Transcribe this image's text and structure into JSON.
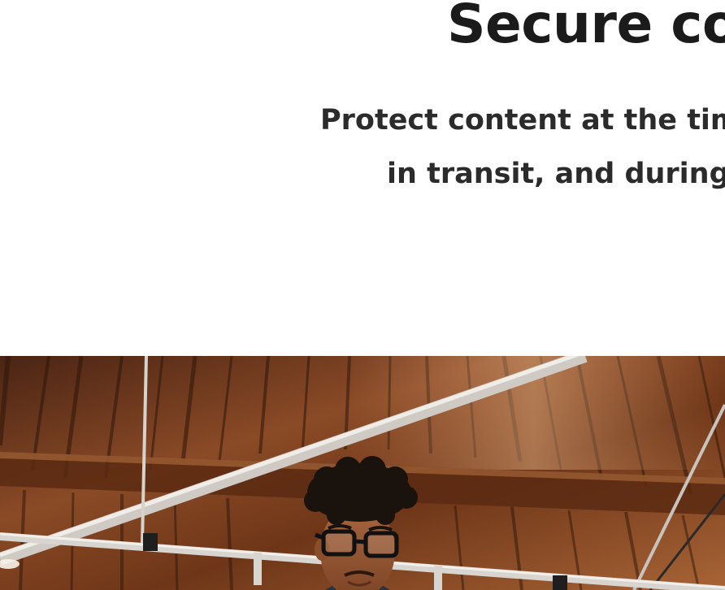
{
  "hero": {
    "heading": "Secure co",
    "subheading_line_1": "Protect content at the tim",
    "subheading_line_2": "in transit, and during"
  },
  "colors": {
    "heading_text": "#1b1b1b",
    "subheading_text": "#2b2b2b",
    "background": "#ffffff",
    "wood_dark": "#3a1d10",
    "wood_mid": "#7a3e20",
    "wood_light": "#b06a3a",
    "pipe": "#d8d4cf"
  },
  "photo": {
    "subject": "person-with-glasses-under-wooden-roof"
  }
}
